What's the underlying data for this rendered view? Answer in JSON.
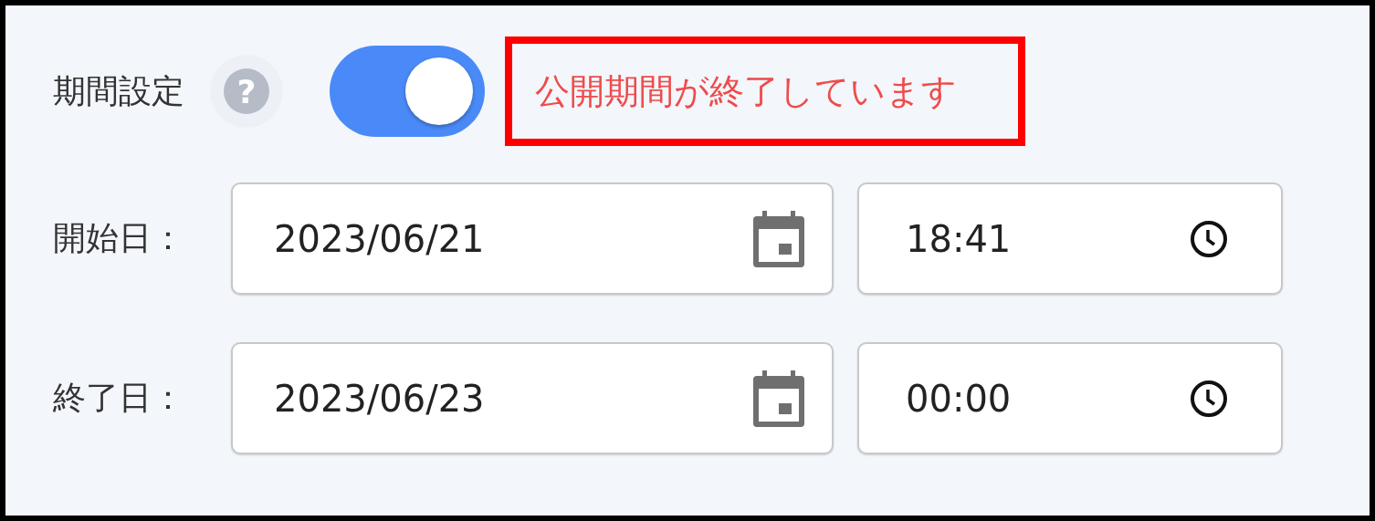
{
  "section": {
    "label": "期間設定",
    "help": "?",
    "toggle": {
      "on": true
    },
    "notice": {
      "text": "公開期間が終了しています",
      "highlighted": true
    }
  },
  "rows": [
    {
      "label": "開始日：",
      "date": "2023/06/21",
      "time": "18:41"
    },
    {
      "label": "終了日：",
      "date": "2023/06/23",
      "time": "00:00"
    }
  ]
}
